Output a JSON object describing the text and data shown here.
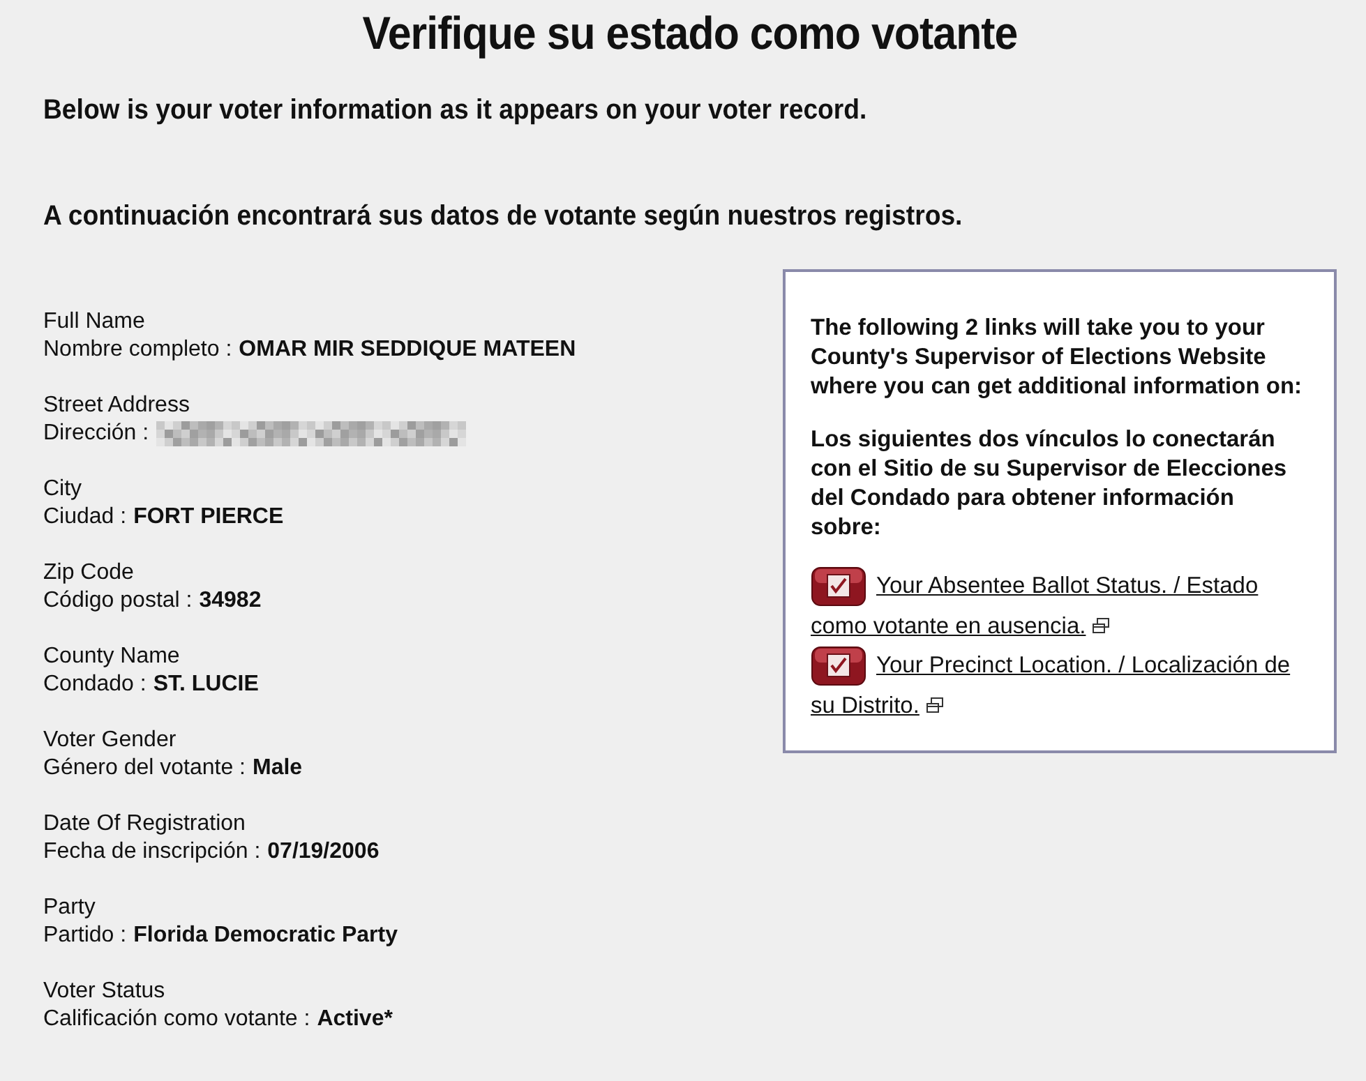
{
  "title": "Verifique su estado como votante",
  "intro": [
    "Below is your voter information as it appears on your voter record.",
    "A continuación encontrará sus datos de votante según nuestros registros."
  ],
  "fields": [
    {
      "kind": "text",
      "heading": "Full Name",
      "label": "Nombre completo :",
      "value": "OMAR MIR SEDDIQUE MATEEN"
    },
    {
      "kind": "redacted",
      "heading": "Street Address",
      "label": "Dirección :"
    },
    {
      "kind": "text",
      "heading": "City",
      "label": "Ciudad :",
      "value": "FORT PIERCE"
    },
    {
      "kind": "text",
      "heading": "Zip Code",
      "label": "Código postal :",
      "value": "34982"
    },
    {
      "kind": "text",
      "heading": "County Name",
      "label": "Condado :",
      "value": "ST. LUCIE"
    },
    {
      "kind": "text",
      "heading": "Voter Gender",
      "label": "Género del votante :",
      "value": "Male"
    },
    {
      "kind": "text",
      "heading": "Date Of Registration",
      "label": "Fecha de inscripción :",
      "value": "07/19/2006"
    },
    {
      "kind": "text",
      "heading": "Party",
      "label": "Partido :",
      "value": "Florida Democratic Party"
    },
    {
      "kind": "text",
      "heading": "Voter Status",
      "label": "Calificación como votante :",
      "value": "Active*"
    }
  ],
  "info_box": {
    "paragraphs": [
      "The following 2 links will take you to your County's Supervisor of Elections Website where you can get additional information on:",
      "Los siguientes dos vínculos lo conectarán con el Sitio de su Supervisor de Elecciones del Condado para obtener información sobre:"
    ],
    "links": [
      {
        "text": "Your Absentee Ballot Status. / Estado como votante en ausencia."
      },
      {
        "text": "Your Precinct Location. / Localización de su Distrito."
      }
    ]
  }
}
